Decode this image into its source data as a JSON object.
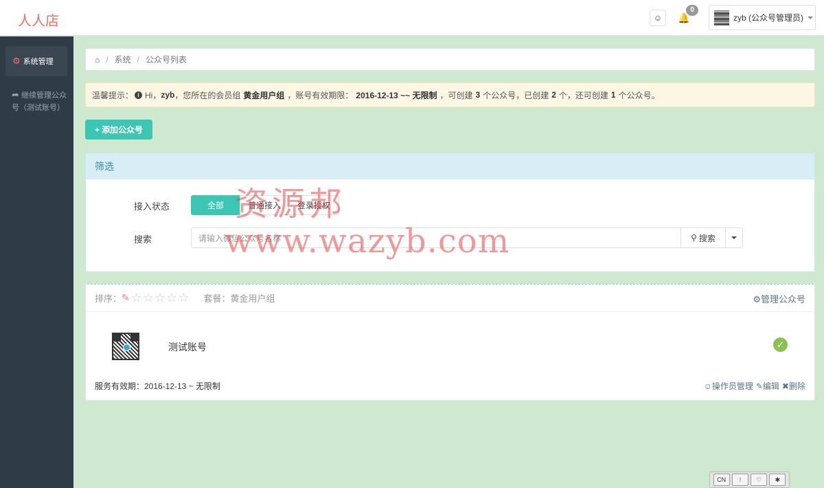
{
  "header": {
    "brand": "人人店",
    "notification_count": "0",
    "user_label": "zyb (公众号管理员)"
  },
  "sidebar": {
    "items": [
      {
        "label": "系统管理",
        "icon": "gears-icon"
      },
      {
        "label": "继续管理公众号（测试账号）",
        "icon": "share-icon"
      }
    ]
  },
  "breadcrumb": {
    "items": [
      "系统",
      "公众号列表"
    ]
  },
  "alert": {
    "prefix": "温馨提示：",
    "hi": "Hi，",
    "user": "zyb",
    "t1": "，您所在的会员组",
    "group": "黄金用户组",
    "t2": "，账号有效期限：",
    "period": "2016-12-13 ~~ 无限制",
    "t3": "，可创建",
    "can_create": "3",
    "t4": "个公众号，已创建",
    "created": "2",
    "t5": "个，还可创建",
    "remaining": "1",
    "t6": "个公众号。"
  },
  "add_button_label": "添加公众号",
  "filter": {
    "title": "筛选",
    "status_label": "接入状态",
    "status_options": [
      "全部",
      "普通接入",
      "登录授权"
    ],
    "status_selected": "全部",
    "search_label": "搜索",
    "search_placeholder": "请输入微信公众号名称",
    "search_button": "搜索"
  },
  "account": {
    "sort_label": "排序：",
    "rating": 0,
    "rating_max": 5,
    "package_label": "套餐：黄金用户组",
    "manage_link": "管理公众号",
    "name": "测试账号",
    "status": "connected",
    "validity": "服务有效期：2016-12-13 ~ 无限制",
    "actions": [
      "操作员管理",
      "编辑",
      "删除"
    ]
  },
  "watermark": {
    "cn": "资源邦",
    "url": "www.wazyb.com"
  },
  "mini_toolbar": [
    "CN",
    "⁝",
    "♡",
    "✱"
  ],
  "colors": {
    "brand": "#f06f5f",
    "accent": "#3ec6b5",
    "sidebar_bg": "#2f3b46",
    "page_bg": "#cfe8d0",
    "filter_head": "#d9edf7",
    "alert_bg": "#fcf7e4",
    "success": "#8cc152"
  }
}
